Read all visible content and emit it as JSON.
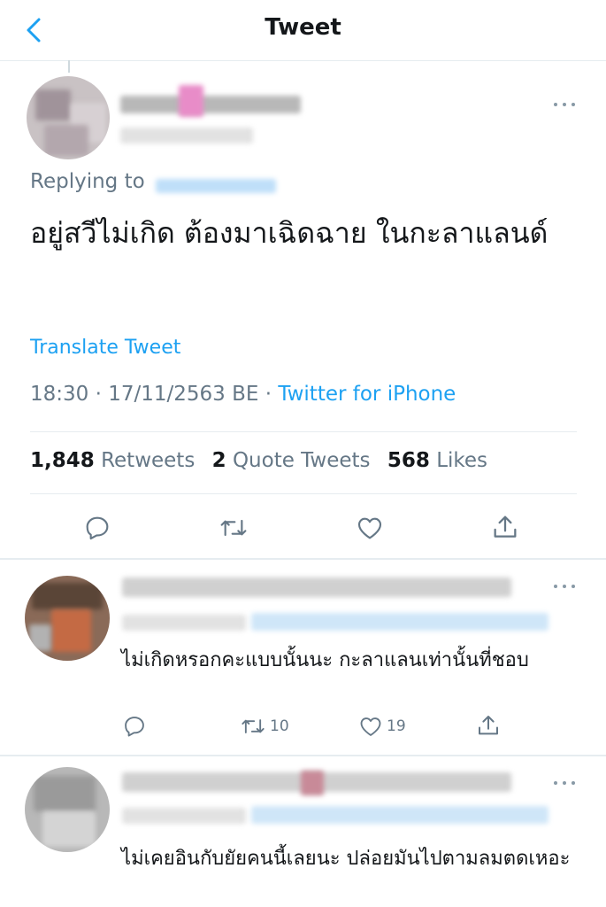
{
  "header": {
    "title": "Tweet",
    "back_icon": "chevron-left-icon"
  },
  "main_tweet": {
    "replying_to_label": "Replying to",
    "text": "อยู่สวีไม่เกิด ต้องมาเฉิดฉาย ในกะลาแลนด์",
    "translate_label": "Translate Tweet",
    "time": "18:30",
    "date": "17/11/2563 BE",
    "dot": "·",
    "source": "Twitter for iPhone",
    "stats": {
      "retweets_count": "1,848",
      "retweets_label": "Retweets",
      "quotes_count": "2",
      "quotes_label": "Quote Tweets",
      "likes_count": "568",
      "likes_label": "Likes"
    },
    "actions": [
      "reply-icon",
      "retweet-icon",
      "like-icon",
      "share-icon"
    ]
  },
  "replies": [
    {
      "text": "ไม่เกิดหรอกคะแบบนั้นนะ กะลาแลนเท่านั้นที่ชอบ",
      "retweets": "10",
      "likes": "19"
    },
    {
      "text": "ไม่เคยอินกับยัยคนนี้เลยนะ ปล่อยมันไปตามลมตดเหอะ"
    }
  ],
  "colors": {
    "accent": "#1da1f2",
    "secondary_text": "#657786",
    "primary_text": "#14171a",
    "divider": "#e6ecf0"
  }
}
